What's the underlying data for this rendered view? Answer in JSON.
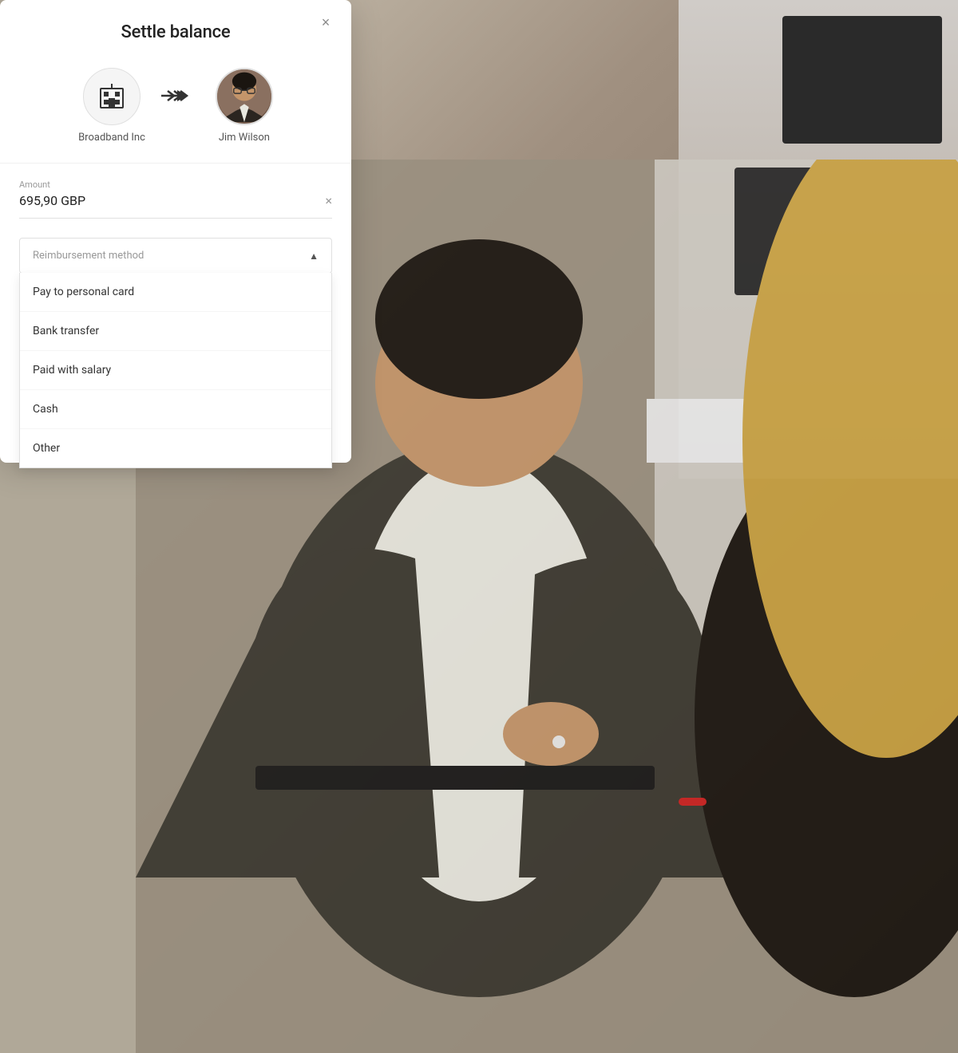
{
  "modal": {
    "title": "Settle balance",
    "close_label": "×",
    "from": {
      "name": "Broadband Inc",
      "type": "building"
    },
    "to": {
      "name": "Jim Wilson",
      "type": "person"
    },
    "amount": {
      "label": "Amount",
      "value": "695,90 GBP"
    },
    "dropdown": {
      "placeholder": "Reimbursement method",
      "options": [
        {
          "label": "Pay to personal card"
        },
        {
          "label": "Bank transfer"
        },
        {
          "label": "Paid with salary"
        },
        {
          "label": "Cash"
        },
        {
          "label": "Other"
        }
      ]
    }
  },
  "colors": {
    "background": "#b0a898",
    "modal_bg": "#ffffff",
    "text_dark": "#222222",
    "text_muted": "#999999",
    "border": "#e0e0e0"
  }
}
